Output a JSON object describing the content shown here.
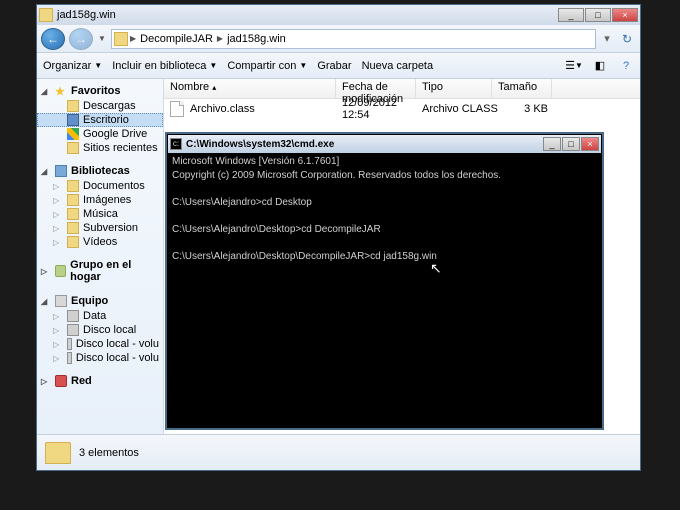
{
  "explorer": {
    "title": "jad158g.win",
    "breadcrumb": {
      "seg1": "DecompileJAR",
      "seg2": "jad158g.win"
    },
    "toolbar": {
      "organizar": "Organizar",
      "incluir": "Incluir en biblioteca",
      "compartir": "Compartir con",
      "grabar": "Grabar",
      "nueva": "Nueva carpeta"
    },
    "sidebar": {
      "favoritos": {
        "label": "Favoritos",
        "items": [
          "Descargas",
          "Escritorio",
          "Google Drive",
          "Sitios recientes"
        ]
      },
      "bibliotecas": {
        "label": "Bibliotecas",
        "items": [
          "Documentos",
          "Imágenes",
          "Música",
          "Subversion",
          "Vídeos"
        ]
      },
      "grupo": {
        "label": "Grupo en el hogar"
      },
      "equipo": {
        "label": "Equipo",
        "items": [
          "Data",
          "Disco local",
          "Disco local - volu",
          "Disco local - volu"
        ]
      },
      "red": {
        "label": "Red"
      }
    },
    "columns": {
      "nombre": "Nombre",
      "fecha": "Fecha de modificación",
      "tipo": "Tipo",
      "tam": "Tamaño"
    },
    "file": {
      "name": "Archivo.class",
      "date": "12/09/2012 12:54",
      "type": "Archivo CLASS",
      "size": "3 KB"
    },
    "status": "3 elementos"
  },
  "cmd": {
    "title": "C:\\Windows\\system32\\cmd.exe",
    "lines": {
      "l1": "Microsoft Windows [Versión 6.1.7601]",
      "l2": "Copyright (c) 2009 Microsoft Corporation. Reservados todos los derechos.",
      "l3": "C:\\Users\\Alejandro>cd Desktop",
      "l4": "C:\\Users\\Alejandro\\Desktop>cd DecompileJAR",
      "l5": "C:\\Users\\Alejandro\\Desktop\\DecompileJAR>cd jad158g.win"
    }
  }
}
